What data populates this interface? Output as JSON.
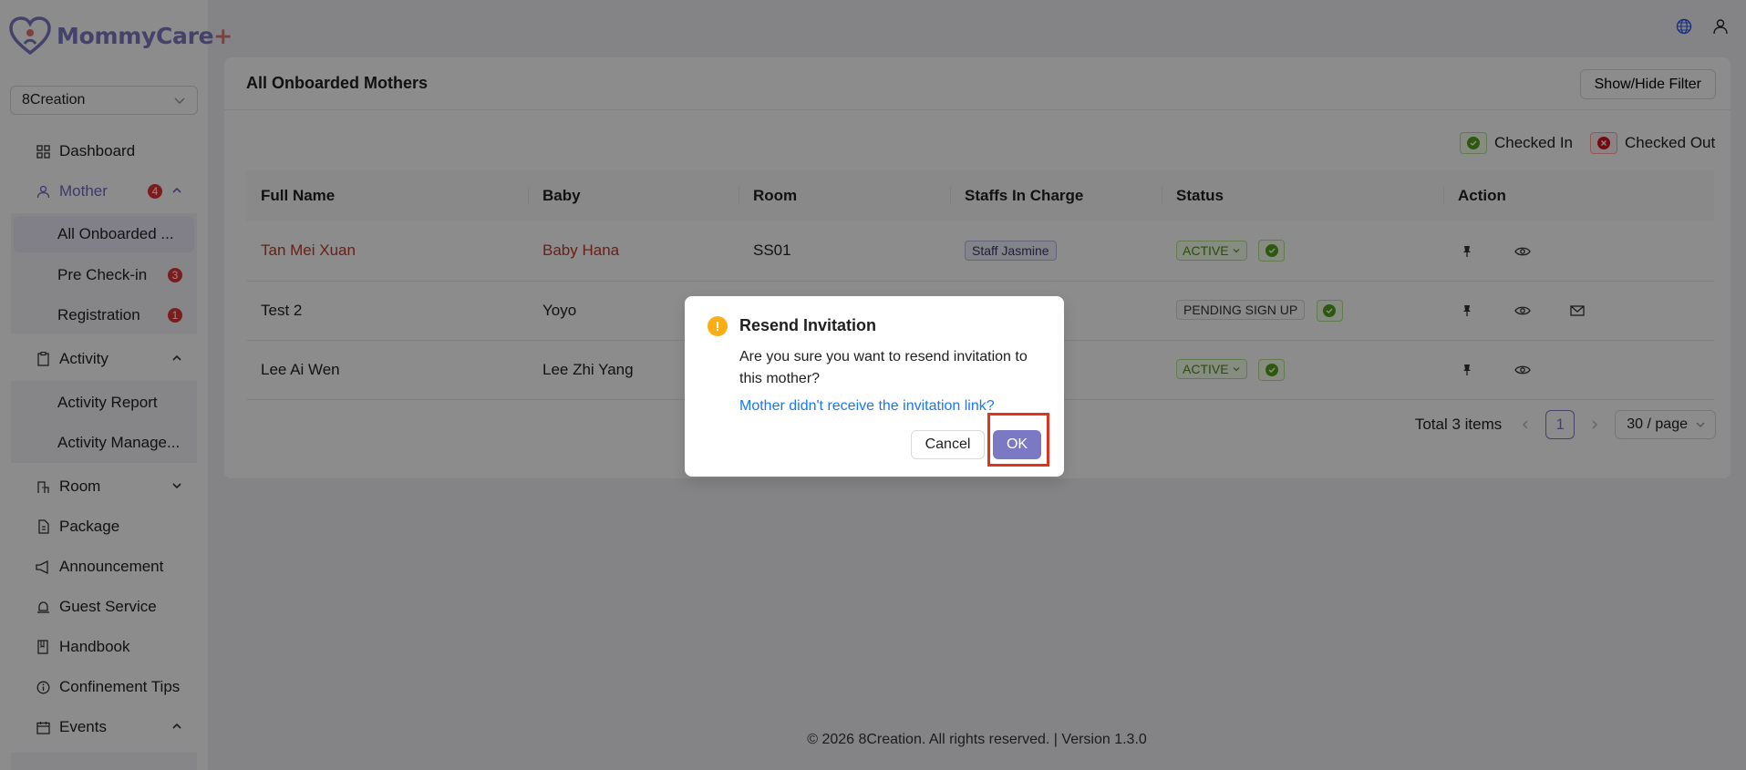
{
  "app": {
    "logo_text": "MommyCare",
    "logo_plus": "+"
  },
  "org_select": {
    "value": "8Creation"
  },
  "sidebar": {
    "items": [
      {
        "label": "Dashboard",
        "icon": "grid-icon"
      },
      {
        "label": "Mother",
        "icon": "user-icon",
        "badge": "4"
      },
      {
        "label": "All Onboarded ...",
        "sub": true
      },
      {
        "label": "Pre Check-in",
        "sub": true,
        "badge": "3"
      },
      {
        "label": "Registration",
        "sub": true,
        "badge": "1"
      },
      {
        "label": "Activity",
        "icon": "clipboard-icon"
      },
      {
        "label": "Activity Report",
        "sub": true
      },
      {
        "label": "Activity Manage...",
        "sub": true
      },
      {
        "label": "Room",
        "icon": "room-icon"
      },
      {
        "label": "Package",
        "icon": "file-icon"
      },
      {
        "label": "Announcement",
        "icon": "megaphone-icon"
      },
      {
        "label": "Guest Service",
        "icon": "bell-icon"
      },
      {
        "label": "Handbook",
        "icon": "book-icon"
      },
      {
        "label": "Confinement Tips",
        "icon": "info-icon"
      },
      {
        "label": "Events",
        "icon": "calendar-icon"
      }
    ]
  },
  "page": {
    "title": "All Onboarded Mothers",
    "filter_button": "Show/Hide Filter",
    "legend": {
      "checked_in": "Checked In",
      "checked_out": "Checked Out"
    }
  },
  "table": {
    "columns": [
      "Full Name",
      "Baby",
      "Room",
      "Staffs In Charge",
      "Status",
      "Action"
    ],
    "rows": [
      {
        "name": "Tan Mei Xuan",
        "baby": "Baby Hana",
        "room": "SS01",
        "staff": "Staff Jasmine",
        "status": "ACTIVE"
      },
      {
        "name": "Test 2",
        "baby": "Yoyo",
        "room": "",
        "staff": "",
        "status": "PENDING SIGN UP"
      },
      {
        "name": "Lee Ai Wen",
        "baby": "Lee Zhi Yang",
        "room": "",
        "staff": "",
        "status": "ACTIVE"
      }
    ]
  },
  "pagination": {
    "total": "Total 3 items",
    "page": "1",
    "page_size": "30 / page"
  },
  "footer": {
    "text": "© 2026 8Creation. All rights reserved. | Version 1.3.0"
  },
  "modal": {
    "title": "Resend Invitation",
    "body": "Are you sure you want to resend invitation to this mother?",
    "link": "Mother didn't receive the invitation link?",
    "cancel": "Cancel",
    "ok": "OK"
  },
  "colors": {
    "accent": "#7c79c4",
    "danger": "#e0343a",
    "success": "#52a31a",
    "warning": "#faad14",
    "highlight": "#e0341f"
  }
}
